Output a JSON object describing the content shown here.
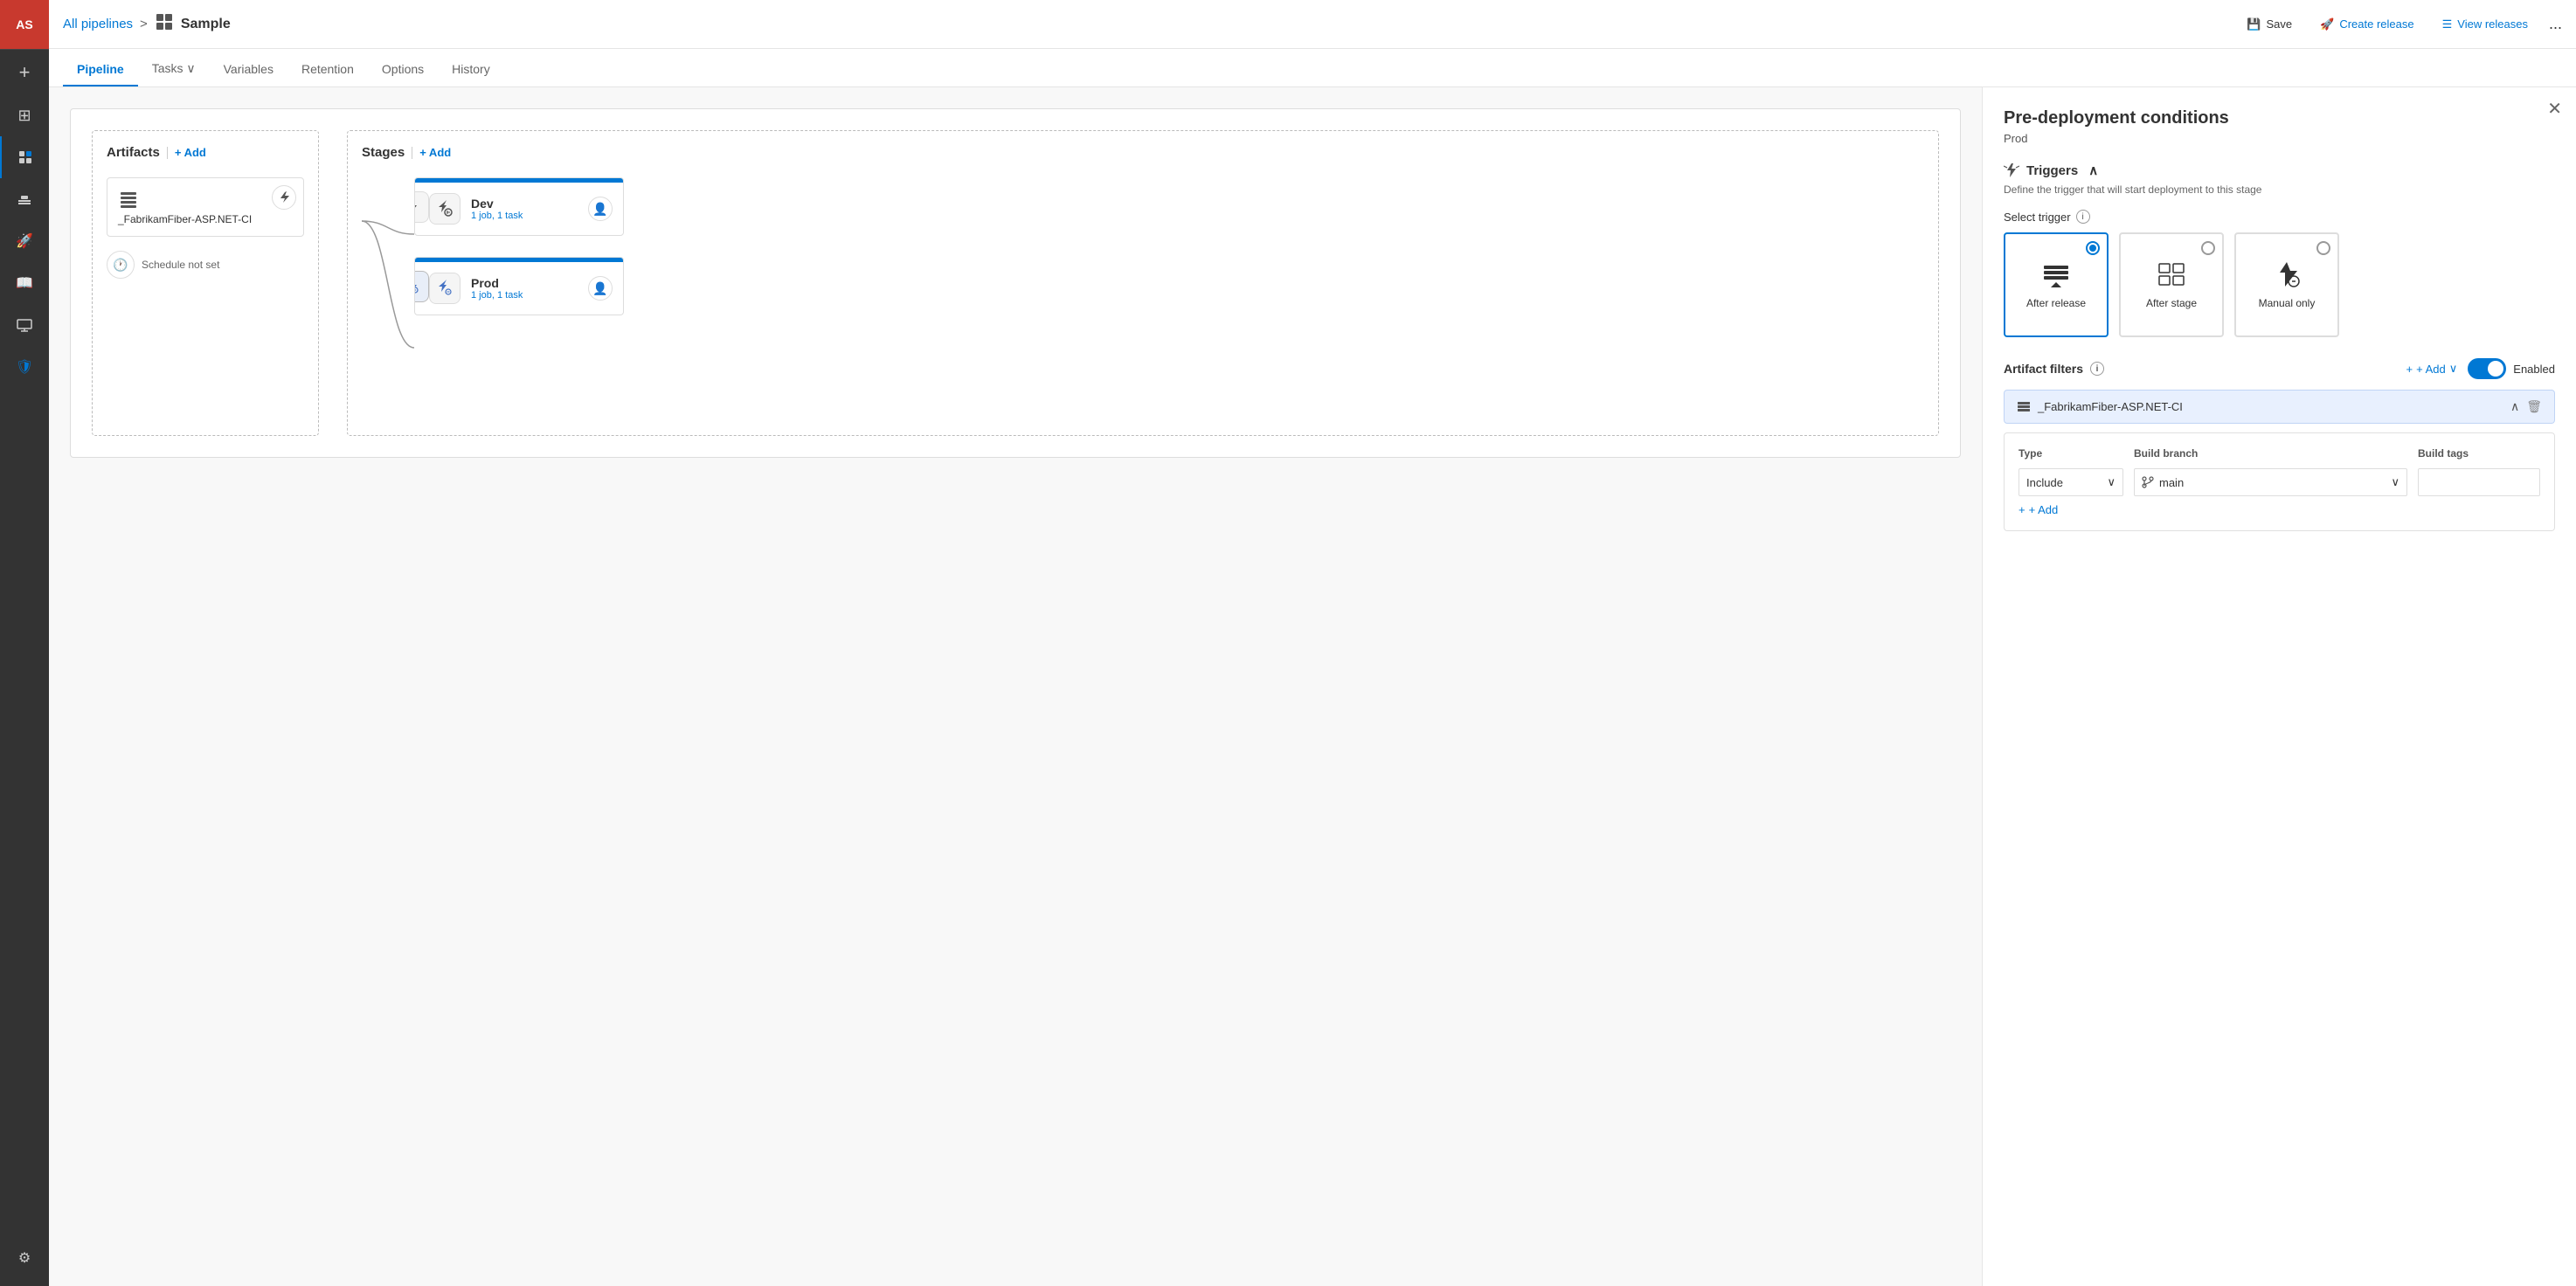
{
  "topbar": {
    "breadcrumb_link": "All pipelines",
    "separator": ">",
    "pipeline_icon": "⑂",
    "pipeline_name": "Sample",
    "save_label": "Save",
    "create_release_label": "Create release",
    "view_releases_label": "View releases",
    "more_icon": "..."
  },
  "tabs": [
    {
      "id": "pipeline",
      "label": "Pipeline",
      "active": true
    },
    {
      "id": "tasks",
      "label": "Tasks",
      "active": false,
      "has_dropdown": true
    },
    {
      "id": "variables",
      "label": "Variables",
      "active": false
    },
    {
      "id": "retention",
      "label": "Retention",
      "active": false
    },
    {
      "id": "options",
      "label": "Options",
      "active": false
    },
    {
      "id": "history",
      "label": "History",
      "active": false
    }
  ],
  "artifacts": {
    "header": "Artifacts",
    "add_label": "+ Add",
    "artifact_name": "_FabrikamFiber-ASP.NET-CI",
    "schedule_label": "Schedule not set"
  },
  "stages": {
    "header": "Stages",
    "add_label": "+ Add",
    "items": [
      {
        "id": "dev",
        "name": "Dev",
        "sub": "1 job, 1 task"
      },
      {
        "id": "prod",
        "name": "Prod",
        "sub": "1 job, 1 task"
      }
    ]
  },
  "pre_deploy": {
    "title": "Pre-deployment conditions",
    "subtitle": "Prod",
    "triggers_label": "Triggers",
    "triggers_collapse_icon": "∧",
    "triggers_desc": "Define the trigger that will start deployment to this stage",
    "select_trigger_label": "Select trigger",
    "trigger_options": [
      {
        "id": "after-release",
        "label": "After release",
        "selected": true
      },
      {
        "id": "after-stage",
        "label": "After stage",
        "selected": false
      },
      {
        "id": "manual-only",
        "label": "Manual only",
        "selected": false
      }
    ],
    "artifact_filters_label": "Artifact filters",
    "artifact_filters_toggle": "Enabled",
    "add_filter_label": "+ Add",
    "artifact_filter_name": "_FabrikamFiber-ASP.NET-CI",
    "filter_type_label": "Type",
    "filter_branch_label": "Build branch",
    "filter_tags_label": "Build tags",
    "filter_type_value": "Include",
    "filter_branch_value": "main",
    "filter_add_label": "+ Add"
  },
  "sidebar": {
    "avatar": "AS",
    "add_icon": "+",
    "icons": [
      {
        "id": "board",
        "symbol": "⊞",
        "active": false
      },
      {
        "id": "pipelines",
        "symbol": "⑂",
        "active": true
      },
      {
        "id": "deploy",
        "symbol": "⊟",
        "active": false
      },
      {
        "id": "rockets",
        "symbol": "🚀",
        "active": false
      },
      {
        "id": "library",
        "symbol": "📚",
        "active": false
      },
      {
        "id": "monitor",
        "symbol": "▦",
        "active": false
      },
      {
        "id": "shield",
        "symbol": "🛡",
        "active": false
      }
    ],
    "settings_icon": "⚙"
  }
}
